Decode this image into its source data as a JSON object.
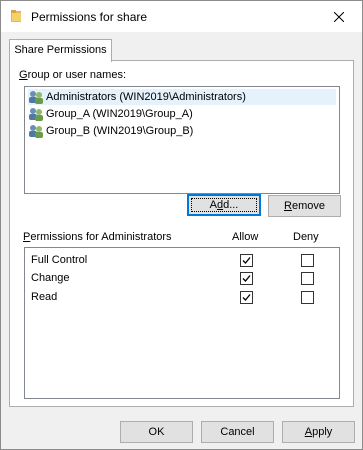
{
  "window": {
    "title": "Permissions for share",
    "title_icon": "folder-icon",
    "close_icon": "close-icon"
  },
  "tabs": [
    {
      "label": "Share Permissions",
      "active": true
    }
  ],
  "group_section": {
    "label": "Group or user names:",
    "label_accesskey": "G",
    "label_rest": "roup or user names:",
    "items": [
      {
        "name": "Administrators (WIN2019\\Administrators)",
        "selected": true,
        "icon": "user-group-icon"
      },
      {
        "name": "Group_A (WIN2019\\Group_A)",
        "selected": false,
        "icon": "user-group-icon"
      },
      {
        "name": "Group_B (WIN2019\\Group_B)",
        "selected": false,
        "icon": "user-group-icon"
      }
    ]
  },
  "buttons": {
    "add": {
      "accesskey": "d",
      "before": "A",
      "after": "d..."
    },
    "remove": {
      "accesskey": "R",
      "rest": "emove"
    }
  },
  "permissions": {
    "label_accesskey": "P",
    "label_rest": "ermissions for Administrators",
    "allow_header": "Allow",
    "deny_header": "Deny",
    "rows": [
      {
        "label": "Full Control",
        "allow": true,
        "deny": false
      },
      {
        "label": "Change",
        "allow": true,
        "deny": false
      },
      {
        "label": "Read",
        "allow": true,
        "deny": false
      }
    ]
  },
  "footer": {
    "ok": "OK",
    "cancel": "Cancel",
    "apply_accesskey": "A",
    "apply_rest": "pply"
  },
  "colors": {
    "selection": "#e5f1fb",
    "default_button_border": "#0078d7"
  }
}
